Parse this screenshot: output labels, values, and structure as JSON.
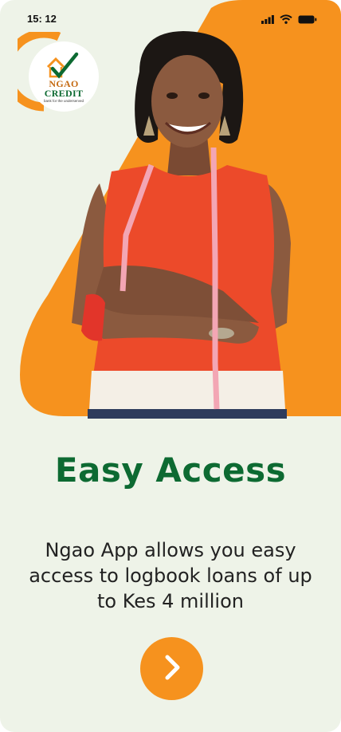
{
  "status_bar": {
    "time": "15: 12",
    "icons": [
      "signal-icon",
      "wifi-icon",
      "battery-icon"
    ]
  },
  "logo": {
    "brand_line1": "NGAO",
    "brand_line2": "CREDIT",
    "tagline": "bank for the underserved"
  },
  "onboarding": {
    "title": "Easy Access",
    "description": "Ngao App allows you easy access to logbook loans of up to Kes 4 million",
    "next_icon": "chevron-right-icon"
  },
  "colors": {
    "accent_orange": "#f6921e",
    "title_green": "#0d6a32",
    "background": "#eef3e8"
  }
}
